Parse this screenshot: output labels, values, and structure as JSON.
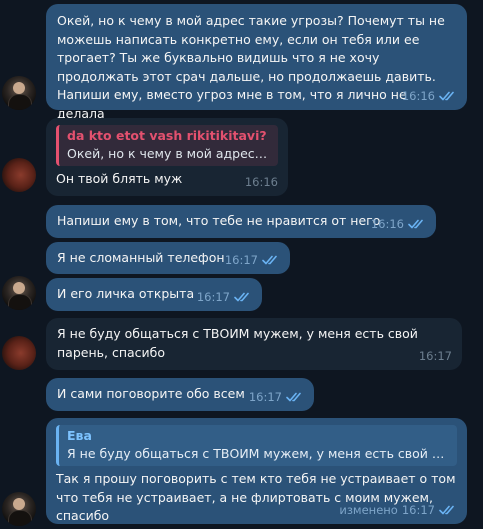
{
  "colors": {
    "background": "#0e1621",
    "outgoing_bubble": "#2b5278",
    "incoming_bubble": "#182533",
    "reply_accent_pink": "#e4516f",
    "reply_accent_blue": "#6ab3f3"
  },
  "messages": [
    {
      "direction": "out",
      "text": "Окей, но к чему в мой адрес такие угрозы? Почемут ты не можешь написать конкретно ему, если он тебя или ее трогает? Ты же буквально видишь что я не хочу продолжать этот срач дальше, но продолжаешь давить. Напиши ему, вместо угроз мне в том, что я лично не делала",
      "time": "16:16",
      "status_icon": "double-check-icon"
    },
    {
      "direction": "in",
      "reply_to": {
        "name": "da kto etot vash rikitikitavi?",
        "text": "Окей, но к чему в мой адрес та..."
      },
      "text": "Он твой блять муж",
      "time": "16:16"
    },
    {
      "direction": "out",
      "text": "Напиши ему в том, что тебе не нравится от него",
      "time": "16:16",
      "status_icon": "double-check-icon"
    },
    {
      "direction": "out",
      "text": "Я не сломанный телефон",
      "time": "16:17",
      "status_icon": "double-check-icon"
    },
    {
      "direction": "out",
      "text": "И его личка открыта",
      "time": "16:17",
      "status_icon": "double-check-icon"
    },
    {
      "direction": "in",
      "text": "Я не буду общаться с ТВОИМ мужем, у меня есть свой парень, спасибо",
      "time": "16:17"
    },
    {
      "direction": "out",
      "text": "И сами поговорите обо всем",
      "time": "16:17",
      "status_icon": "double-check-icon"
    },
    {
      "direction": "out",
      "reply_to": {
        "name": "Ева",
        "text": "Я не буду общаться с ТВОИМ мужем, у меня есть свой парe..."
      },
      "text": "Так я прошу поговорить с тем кто тебя не устраивает о том что тебя не устраивает, а не флиртовать с моим мужем, спасибо",
      "edited_label": "изменено",
      "time": "16:17",
      "status_icon": "double-check-icon"
    }
  ]
}
